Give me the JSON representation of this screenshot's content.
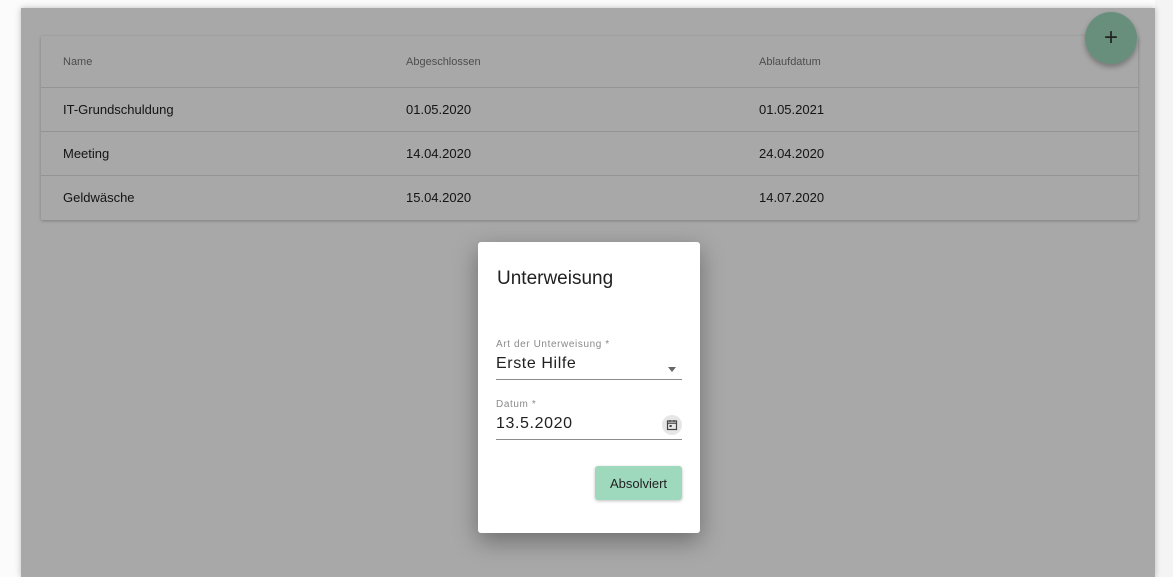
{
  "table": {
    "headers": [
      "Name",
      "Abgeschlossen",
      "Ablaufdatum"
    ],
    "rows": [
      [
        "IT-Grundschuldung",
        "01.05.2020",
        "01.05.2021"
      ],
      [
        "Meeting",
        "14.04.2020",
        "24.04.2020"
      ],
      [
        "Geldwäsche",
        "15.04.2020",
        "14.07.2020"
      ]
    ]
  },
  "fab": {
    "icon": "plus-icon",
    "label": "+"
  },
  "dialog": {
    "title": "Unterweisung",
    "type_field": {
      "label": "Art der Unterweisung *",
      "value": "Erste Hilfe",
      "icon": "chevron-down-icon"
    },
    "date_field": {
      "label": "Datum *",
      "value": "13.5.2020",
      "icon": "calendar-icon"
    },
    "submit_label": "Absolviert"
  },
  "colors": {
    "accent": "#9fd9bd",
    "overlay": "rgba(0,0,0,0.34)"
  }
}
